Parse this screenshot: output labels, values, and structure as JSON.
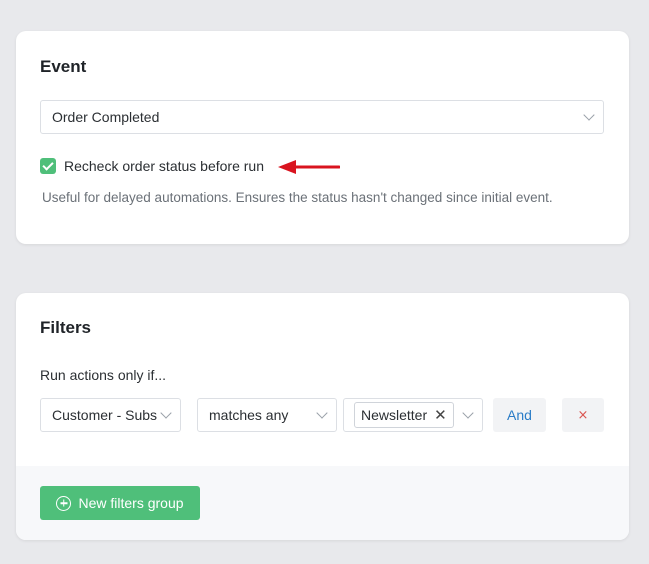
{
  "event": {
    "title": "Event",
    "select_value": "Order Completed",
    "recheck_checked": true,
    "recheck_label": "Recheck order status before run",
    "help_text": "Useful for delayed automations. Ensures the status hasn't changed since initial event."
  },
  "filters": {
    "title": "Filters",
    "run_label": "Run actions only if...",
    "rows": [
      {
        "field": "Customer - Subs",
        "operator": "matches any",
        "values": [
          "Newsletter"
        ]
      }
    ],
    "and_label": "And",
    "remove_label": "×",
    "new_group_label": "New filters group"
  },
  "colors": {
    "accent_green": "#4fbf7a",
    "link_blue": "#2a7cc7",
    "danger_red": "#d9534f",
    "arrow_red": "#d9141f"
  }
}
